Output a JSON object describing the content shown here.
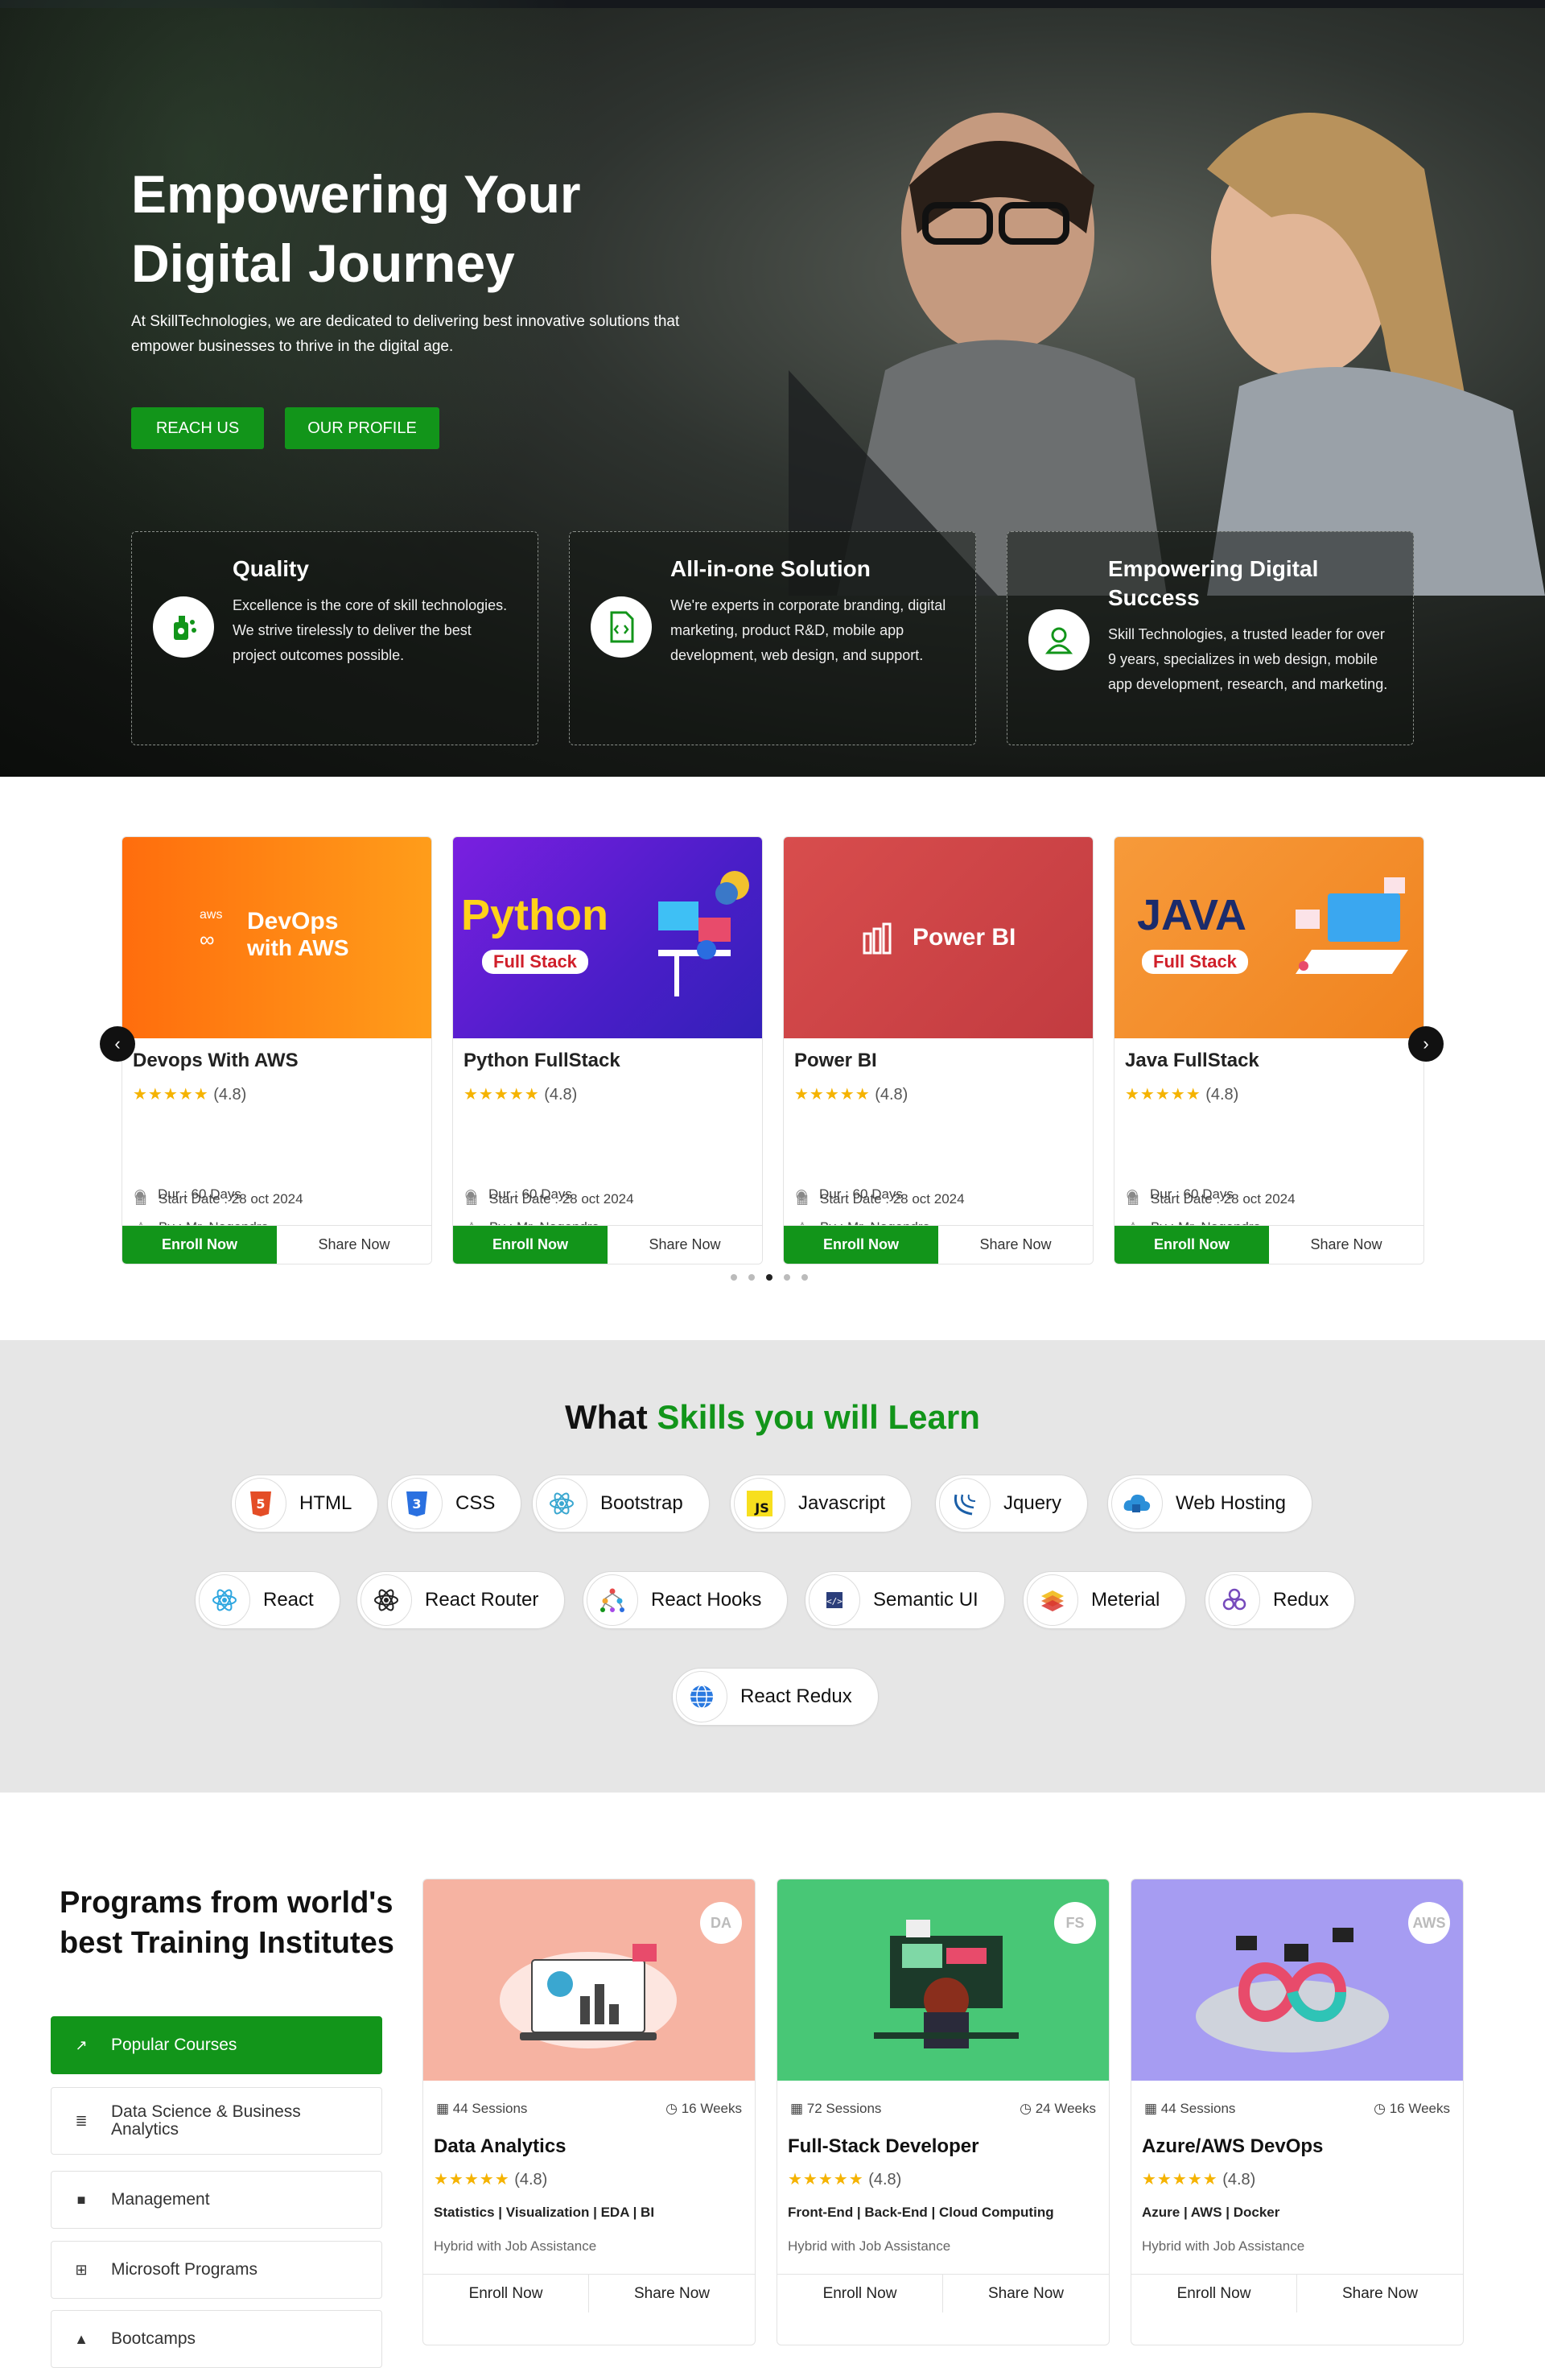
{
  "hero": {
    "title": "Empowering Your Digital Journey",
    "subtitle": "At SkillTechnologies, we are dedicated to delivering best innovative solutions that empower businesses to thrive in the digital age.",
    "buttons": {
      "reach": "REACH US",
      "profile": "OUR PROFILE"
    },
    "features": [
      {
        "title": "Quality",
        "text": "Excellence is the core of skill technologies. We strive tirelessly to deliver the best project outcomes possible.",
        "icon": "quality-icon"
      },
      {
        "title": "All-in-one Solution",
        "text": "We're experts in corporate branding, digital marketing, product R&D, mobile app development, web design, and support.",
        "icon": "code-file-icon"
      },
      {
        "title": "Empowering Digital Success",
        "text": "Skill Technologies, a trusted leader for over 9 years, specializes in web design, mobile app development, research, and marketing.",
        "icon": "user-icon"
      }
    ]
  },
  "courses": [
    {
      "banner_line1": "DevOps",
      "banner_line2": "with AWS",
      "banner_small": "aws",
      "title": "Devops With AWS",
      "rating": "(4.8)",
      "start": "Start Date : 28 oct 2024",
      "by": "By : Mr. Nagendra",
      "dur": "Dur : 60 Days"
    },
    {
      "banner_line1": "Python",
      "banner_tag": "Full Stack",
      "title": "Python FullStack",
      "rating": "(4.8)",
      "start": "Start Date : 28 oct 2024",
      "by": "By : Mr. Nagendra",
      "dur": "Dur : 60 Days"
    },
    {
      "banner_line1": "Power BI",
      "title": "Power BI",
      "rating": "(4.8)",
      "start": "Start Date : 28 oct 2024",
      "by": "By : Mr. Nagendra",
      "dur": "Dur : 60 Days"
    },
    {
      "banner_line1": "JAVA",
      "banner_tag": "Full Stack",
      "title": "Java FullStack",
      "rating": "(4.8)",
      "start": "Start Date : 28 oct 2024",
      "by": "By : Mr. Nagendra",
      "dur": "Dur : 60 Days"
    }
  ],
  "course_actions": {
    "enroll": "Enroll Now",
    "share": "Share Now"
  },
  "carousel": {
    "active_dot": 3,
    "dot_count": 5
  },
  "skills": {
    "title_plain": "What ",
    "title_green": "Skills you will Learn",
    "items": [
      {
        "label": "HTML",
        "icon": "html5-icon"
      },
      {
        "label": "CSS",
        "icon": "css3-icon"
      },
      {
        "label": "Bootstrap",
        "icon": "bootstrap-icon"
      },
      {
        "label": "Javascript",
        "icon": "javascript-icon"
      },
      {
        "label": "Jquery",
        "icon": "jquery-icon"
      },
      {
        "label": "Web Hosting",
        "icon": "cloud-icon"
      },
      {
        "label": "React",
        "icon": "react-icon"
      },
      {
        "label": "React Router",
        "icon": "react-router-icon"
      },
      {
        "label": "React Hooks",
        "icon": "hooks-icon"
      },
      {
        "label": "Semantic UI",
        "icon": "semantic-ui-icon"
      },
      {
        "label": "Meterial",
        "icon": "material-icon"
      },
      {
        "label": "Redux",
        "icon": "redux-icon"
      },
      {
        "label": "React Redux",
        "icon": "globe-icon"
      }
    ]
  },
  "programs": {
    "title": "Programs from world's best Training Institutes",
    "menu": [
      {
        "label": "Popular Courses",
        "icon": "external-link-icon"
      },
      {
        "label": "Data Science & Business Analytics",
        "icon": "database-icon"
      },
      {
        "label": "Management",
        "icon": "briefcase-icon"
      },
      {
        "label": "Microsoft Programs",
        "icon": "windows-icon"
      },
      {
        "label": "Bootcamps",
        "icon": "bootcamp-icon"
      }
    ],
    "cards": [
      {
        "badge": "DA",
        "sessions": "44 Sessions",
        "weeks": "16 Weeks",
        "name": "Data Analytics",
        "rating": "(4.8)",
        "tags": "Statistics | Visualization | EDA | BI",
        "mode": "Hybrid with Job Assistance",
        "color": "#f6b3a2"
      },
      {
        "badge": "FS",
        "sessions": "72 Sessions",
        "weeks": "24 Weeks",
        "name": "Full-Stack Developer",
        "rating": "(4.8)",
        "tags": "Front-End | Back-End | Cloud Computing",
        "mode": "Hybrid with Job Assistance",
        "color": "#48c776"
      },
      {
        "badge": "AWS",
        "sessions": "44 Sessions",
        "weeks": "16 Weeks",
        "name": "Azure/AWS DevOps",
        "rating": "(4.8)",
        "tags": "Azure | AWS | Docker",
        "mode": "Hybrid with Job Assistance",
        "color": "#a69cf2"
      }
    ],
    "actions": {
      "enroll": "Enroll Now",
      "share": "Share Now"
    }
  },
  "colors": {
    "accent": "#12951a",
    "dark": "#111111"
  }
}
